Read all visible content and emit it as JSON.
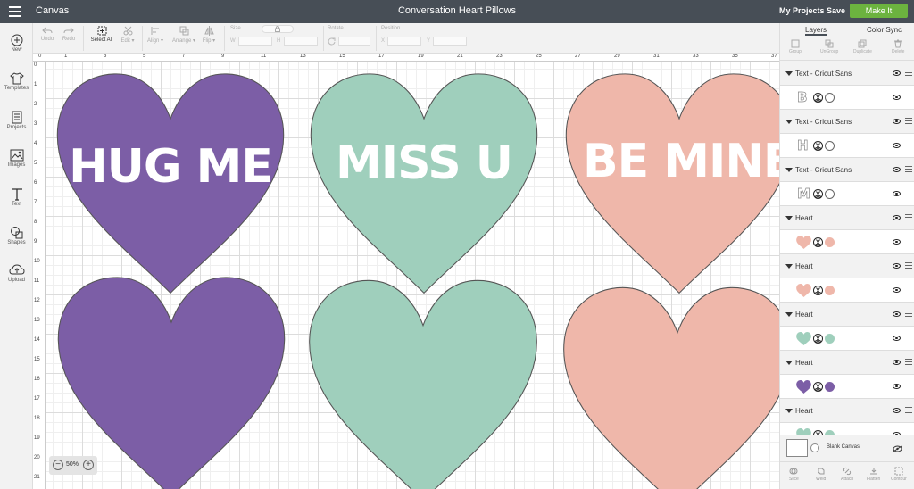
{
  "header": {
    "app_name": "Canvas",
    "project_title": "Conversation Heart Pillows",
    "my_projects": "My Projects",
    "save": "Save",
    "make_it": "Make It"
  },
  "sidebar": {
    "items": [
      {
        "label": "New",
        "icon": "plus-circle-icon"
      },
      {
        "label": "Templates",
        "icon": "shirt-icon"
      },
      {
        "label": "Projects",
        "icon": "projects-icon"
      },
      {
        "label": "Images",
        "icon": "image-icon"
      },
      {
        "label": "Text",
        "icon": "text-icon"
      },
      {
        "label": "Shapes",
        "icon": "shapes-icon"
      },
      {
        "label": "Upload",
        "icon": "upload-icon"
      }
    ]
  },
  "toolbar": {
    "undo": "Undo",
    "redo": "Redo",
    "select_all": "Select All",
    "edit": "Edit",
    "align": "Align",
    "arrange": "Arrange",
    "flip": "Flip",
    "size": "Size",
    "w": "W",
    "h": "H",
    "rotate": "Rotate",
    "position": "Position",
    "x": "X",
    "y": "Y"
  },
  "rulers": {
    "top": [
      "0",
      "1",
      "3",
      "5",
      "7",
      "9",
      "11",
      "13",
      "15",
      "17",
      "19",
      "21",
      "23",
      "25",
      "27",
      "29",
      "31",
      "33",
      "35",
      "37"
    ],
    "left": [
      "0",
      "1",
      "2",
      "3",
      "4",
      "5",
      "6",
      "7",
      "8",
      "9",
      "10",
      "11",
      "12",
      "13",
      "14",
      "15",
      "16",
      "17",
      "18",
      "19",
      "20",
      "21"
    ]
  },
  "canvas": {
    "colors": {
      "purple": "#7c5ea6",
      "mint": "#9fcfbc",
      "pink": "#efb7aa"
    },
    "hearts": [
      {
        "color": "#7c5ea6",
        "text": "HUG ME"
      },
      {
        "color": "#9fcfbc",
        "text": "MISS U"
      },
      {
        "color": "#efb7aa",
        "text": "BE MINE"
      },
      {
        "color": "#7c5ea6",
        "text": ""
      },
      {
        "color": "#9fcfbc",
        "text": ""
      },
      {
        "color": "#efb7aa",
        "text": ""
      }
    ],
    "zoom": "50%"
  },
  "layers_panel": {
    "tabs": [
      "Layers",
      "Color Sync"
    ],
    "actions": [
      "Group",
      "UnGroup",
      "Duplicate",
      "Delete"
    ],
    "layers": [
      {
        "name": "Text - Cricut Sans",
        "letter": "B",
        "type": "text"
      },
      {
        "name": "Text - Cricut Sans",
        "letter": "H",
        "type": "text"
      },
      {
        "name": "Text - Cricut Sans",
        "letter": "M",
        "type": "text"
      },
      {
        "name": "Heart",
        "color": "#efb7aa",
        "type": "heart"
      },
      {
        "name": "Heart",
        "color": "#efb7aa",
        "type": "heart"
      },
      {
        "name": "Heart",
        "color": "#9fcfbc",
        "type": "heart"
      },
      {
        "name": "Heart",
        "color": "#7c5ea6",
        "type": "heart"
      },
      {
        "name": "Heart",
        "color": "#9fcfbc",
        "type": "heart"
      }
    ],
    "blank_canvas": "Blank Canvas",
    "bottom_actions": [
      "Slice",
      "Weld",
      "Attach",
      "Flatten",
      "Contour"
    ]
  }
}
